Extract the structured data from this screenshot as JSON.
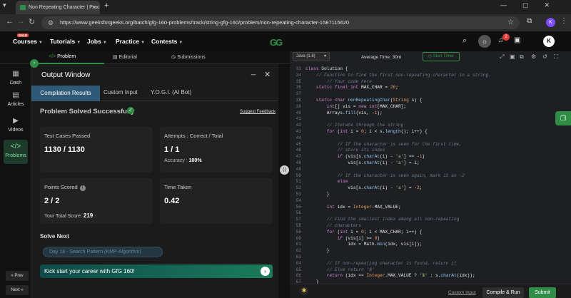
{
  "browser": {
    "tab_title": "Non Repeating Character | Prac",
    "url": "https://www.geeksforgeeks.org/batch/gfg-160-problems/track/string-gfg-160/problem/non-repeating-character-1587115620",
    "profile_initial": "K"
  },
  "gfg_nav": {
    "sale_badge": "SALE",
    "items": [
      "Courses",
      "Tutorials",
      "Jobs",
      "Practice",
      "Contests"
    ],
    "logo_text": "GG",
    "notification_count": "2",
    "avatar_initial": "K"
  },
  "problem_tabs": [
    "Problem",
    "Editorial",
    "Submissions"
  ],
  "sidebar": {
    "items": [
      "Dash",
      "Articles",
      "Videos",
      "Problems"
    ],
    "prev": "« Prev",
    "next": "Next »"
  },
  "output_window": {
    "title": "Output Window",
    "tabs": [
      "Compilation Results",
      "Custom Input",
      "Y.O.G.I. (AI Bot)"
    ],
    "status": "Problem Solved Successfully",
    "feedback": "Suggest Feedback",
    "cards": {
      "tests_label": "Test Cases Passed",
      "tests_value": "1130 / 1130",
      "attempts_label": "Attempts : Correct / Total",
      "attempts_value": "1 / 1",
      "accuracy_label": "Accuracy :",
      "accuracy_value": "100%",
      "points_label": "Points Scored",
      "points_value": "2 / 2",
      "total_label": "Your Total Score:",
      "total_value": "219",
      "time_label": "Time Taken",
      "time_value": "0.42"
    },
    "solve_next": "Solve Next",
    "next_problem": "Day 18 - Search Pattern (KMP-Algorithm)",
    "promo": "Kick start your career with GfG 160!"
  },
  "editor": {
    "language": "Java (1.8)",
    "avg_time": "Average Time: 30m",
    "timer": "Start Timer",
    "line_numbers": [
      "33",
      "34",
      "35",
      "36",
      "37",
      "38",
      "39",
      "40",
      "41",
      "42",
      "43",
      "44",
      "45",
      "46",
      "47",
      "48",
      "49",
      "50",
      "51",
      "52",
      "53",
      "54",
      "55",
      "56",
      "57",
      "58",
      "59",
      "60",
      "61",
      "62",
      "63",
      "64",
      "65",
      "66",
      "67",
      "68",
      "69"
    ],
    "custom_input": "Custom Input",
    "compile": "Compile & Run",
    "submit": "Submit"
  }
}
